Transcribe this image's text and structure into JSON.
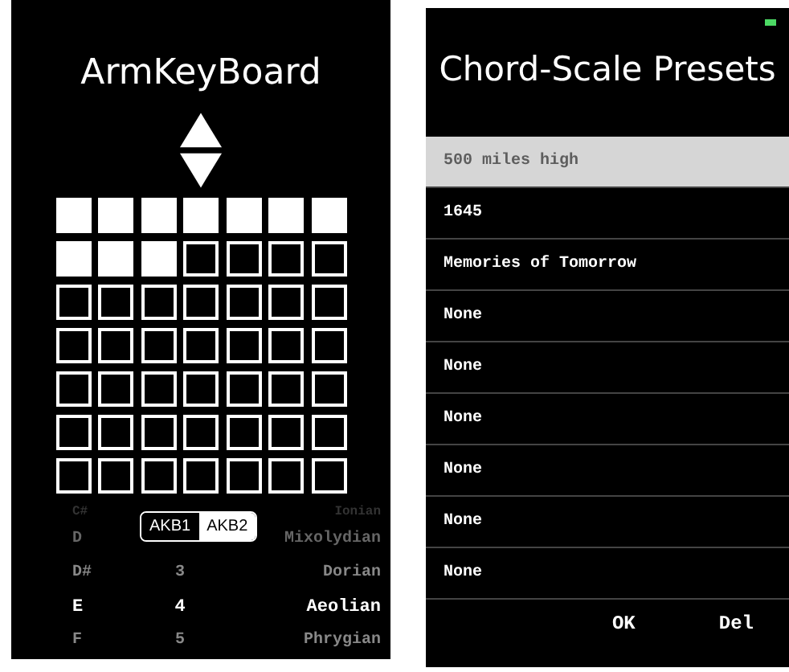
{
  "keyboard_screen": {
    "title": "ArmKeyBoard",
    "grid": [
      [
        true,
        true,
        true,
        true,
        true,
        true,
        true
      ],
      [
        true,
        true,
        true,
        false,
        false,
        false,
        false
      ],
      [
        false,
        false,
        false,
        false,
        false,
        false,
        false
      ],
      [
        false,
        false,
        false,
        false,
        false,
        false,
        false
      ],
      [
        false,
        false,
        false,
        false,
        false,
        false,
        false
      ],
      [
        false,
        false,
        false,
        false,
        false,
        false,
        false
      ],
      [
        false,
        false,
        false,
        false,
        false,
        false,
        false
      ]
    ],
    "segments": [
      {
        "label": "AKB1",
        "selected": false
      },
      {
        "label": "AKB2",
        "selected": true
      }
    ],
    "picker_rows": [
      {
        "note": "C#",
        "mode": "Ionian",
        "selected": false
      },
      {
        "note": "D",
        "mode": "Mixolydian",
        "selected": false
      },
      {
        "note": "D#",
        "number": "3",
        "mode": "Dorian",
        "selected": false
      },
      {
        "note": "E",
        "number": "4",
        "mode": "Aeolian",
        "selected": true
      },
      {
        "note": "F",
        "number": "5",
        "mode": "Phrygian",
        "selected": false
      }
    ]
  },
  "presets_screen": {
    "title": "Chord-Scale Presets",
    "presets": [
      {
        "name": "500 miles high",
        "selected": true
      },
      {
        "name": "1645",
        "selected": false
      },
      {
        "name": "Memories of Tomorrow",
        "selected": false
      },
      {
        "name": "None",
        "selected": false
      },
      {
        "name": "None",
        "selected": false
      },
      {
        "name": "None",
        "selected": false
      },
      {
        "name": "None",
        "selected": false
      },
      {
        "name": "None",
        "selected": false
      },
      {
        "name": "None",
        "selected": false
      }
    ],
    "buttons": [
      "OK",
      "Del"
    ]
  }
}
